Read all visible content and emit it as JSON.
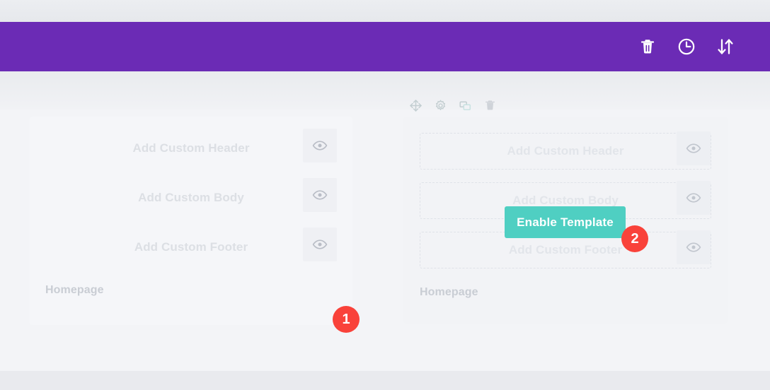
{
  "toolbar": {
    "icons": [
      {
        "name": "trash-icon",
        "label": "Delete"
      },
      {
        "name": "clock-icon",
        "label": "History"
      },
      {
        "name": "sort-icon",
        "label": "Sort"
      }
    ]
  },
  "hover_toolbar": {
    "icons": [
      {
        "name": "move-icon",
        "label": "Move"
      },
      {
        "name": "gear-icon",
        "label": "Settings"
      },
      {
        "name": "duplicate-icon",
        "label": "Duplicate"
      },
      {
        "name": "trash-icon",
        "label": "Delete"
      }
    ]
  },
  "cards": {
    "left": {
      "title": "Homepage",
      "rows": [
        {
          "label": "Add Custom Header",
          "toggle_icon": "eye-icon"
        },
        {
          "label": "Add Custom Body",
          "toggle_icon": "eye-icon"
        },
        {
          "label": "Add Custom Footer",
          "toggle_icon": "eye-icon"
        }
      ]
    },
    "right": {
      "title": "Homepage",
      "rows": [
        {
          "label": "Add Custom Header",
          "toggle_icon": "eye-icon"
        },
        {
          "label": "Add Custom Body",
          "toggle_icon": "eye-icon"
        },
        {
          "label": "Add Custom Footer",
          "toggle_icon": "eye-icon"
        }
      ],
      "enable_button": "Enable Template"
    }
  },
  "annotations": {
    "step_one": "1",
    "step_two": "2"
  },
  "colors": {
    "header_purple": "#6b2bb5",
    "accent_teal": "#4fcfc2",
    "badge_red": "#f9423a",
    "canvas": "#f3f4f7"
  }
}
